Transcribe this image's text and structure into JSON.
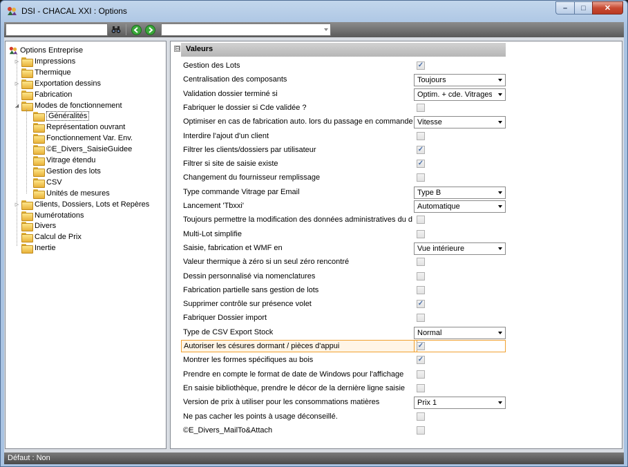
{
  "window": {
    "title": "DSI - CHACAL XXI : Options"
  },
  "toolbar": {
    "search_value": "",
    "combo_value": ""
  },
  "tree": [
    {
      "label": "Options Entreprise",
      "level": 0,
      "kind": "root"
    },
    {
      "label": "Impressions",
      "level": 1,
      "kind": "folder",
      "expander": "collapsed"
    },
    {
      "label": "Thermique",
      "level": 1,
      "kind": "folder"
    },
    {
      "label": "Exportation dessins",
      "level": 1,
      "kind": "folder",
      "expander": "collapsed"
    },
    {
      "label": "Fabrication",
      "level": 1,
      "kind": "folder"
    },
    {
      "label": "Modes de fonctionnement",
      "level": 1,
      "kind": "folder",
      "expander": "expanded"
    },
    {
      "label": "Généralités",
      "level": 2,
      "kind": "folder",
      "selected": true
    },
    {
      "label": "Représentation ouvrant",
      "level": 2,
      "kind": "folder"
    },
    {
      "label": "Fonctionnement Var. Env.",
      "level": 2,
      "kind": "folder"
    },
    {
      "label": "©E_Divers_SaisieGuidee",
      "level": 2,
      "kind": "folder"
    },
    {
      "label": "Vitrage étendu",
      "level": 2,
      "kind": "folder"
    },
    {
      "label": "Gestion des lots",
      "level": 2,
      "kind": "folder"
    },
    {
      "label": "CSV",
      "level": 2,
      "kind": "folder"
    },
    {
      "label": "Unités de mesures",
      "level": 2,
      "kind": "folder"
    },
    {
      "label": "Clients, Dossiers, Lots et Repères",
      "level": 1,
      "kind": "folder",
      "expander": "collapsed"
    },
    {
      "label": "Numérotations",
      "level": 1,
      "kind": "folder"
    },
    {
      "label": "Divers",
      "level": 1,
      "kind": "folder"
    },
    {
      "label": "Calcul de Prix",
      "level": 1,
      "kind": "folder"
    },
    {
      "label": "Inertie",
      "level": 1,
      "kind": "folder"
    }
  ],
  "section": {
    "title": "Valeurs",
    "collapse_glyph": "⊟"
  },
  "properties": [
    {
      "label": "Gestion des Lots",
      "type": "check",
      "checked": true
    },
    {
      "label": "Centralisation des composants",
      "type": "combo",
      "value": "Toujours"
    },
    {
      "label": "Validation dossier terminé si",
      "type": "combo",
      "value": "Optim. + cde. Vitrages"
    },
    {
      "label": "Fabriquer le dossier si Cde validée ?",
      "type": "check",
      "checked": false
    },
    {
      "label": "Optimiser en cas de fabrication auto. lors du passage en commande",
      "type": "combo",
      "value": "Vitesse"
    },
    {
      "label": "Interdire l'ajout d'un client",
      "type": "check",
      "checked": false
    },
    {
      "label": "Filtrer les clients/dossiers par utilisateur",
      "type": "check",
      "checked": true
    },
    {
      "label": "Filtrer si site de saisie existe",
      "type": "check",
      "checked": true
    },
    {
      "label": "Changement du fournisseur remplissage",
      "type": "check",
      "checked": false
    },
    {
      "label": "Type commande Vitrage par Email",
      "type": "combo",
      "value": "Type B"
    },
    {
      "label": "Lancement 'Tbxxi'",
      "type": "combo",
      "value": "Automatique"
    },
    {
      "label": "Toujours permettre la modification des données administratives du d",
      "type": "check",
      "checked": false
    },
    {
      "label": "Multi-Lot simplifie",
      "type": "check",
      "checked": false
    },
    {
      "label": "Saisie, fabrication et WMF en",
      "type": "combo",
      "value": "Vue intérieure"
    },
    {
      "label": "Valeur thermique à zéro si un seul zéro rencontré",
      "type": "check",
      "checked": false
    },
    {
      "label": "Dessin personnalisé via nomenclatures",
      "type": "check",
      "checked": false
    },
    {
      "label": "Fabrication partielle sans gestion de lots",
      "type": "check",
      "checked": false
    },
    {
      "label": "Supprimer contrôle sur présence volet",
      "type": "check",
      "checked": true
    },
    {
      "label": "Fabriquer Dossier import",
      "type": "check",
      "checked": false
    },
    {
      "label": "Type de CSV Export Stock",
      "type": "combo",
      "value": "Normal"
    },
    {
      "label": "Autoriser les césures dormant / pièces d'appui",
      "type": "check",
      "checked": true,
      "highlight": true
    },
    {
      "label": "Montrer les formes spécifiques au bois",
      "type": "check",
      "checked": true
    },
    {
      "label": "Prendre en compte le format de date de Windows pour l'affichage",
      "type": "check",
      "checked": false
    },
    {
      "label": "En saisie bibliothèque, prendre le décor de la dernière ligne saisie",
      "type": "check",
      "checked": false
    },
    {
      "label": "Version de prix à utiliser pour les consommations matières",
      "type": "combo",
      "value": "Prix 1"
    },
    {
      "label": "Ne pas cacher les points à usage déconseillé.",
      "type": "check",
      "checked": false
    },
    {
      "label": "©E_Divers_MailTo&Attach",
      "type": "check",
      "checked": false
    }
  ],
  "status": {
    "text": "Défaut : Non"
  },
  "colors": {
    "accent": "#f0a030",
    "titlebar": "#a9c3e2",
    "close": "#c84a32"
  },
  "icons": [
    "app-icon",
    "binoculars-icon",
    "back-icon",
    "forward-icon",
    "minimize-icon",
    "maximize-icon",
    "close-icon",
    "folder-icon",
    "dropdown-arrow-icon",
    "check-icon"
  ]
}
